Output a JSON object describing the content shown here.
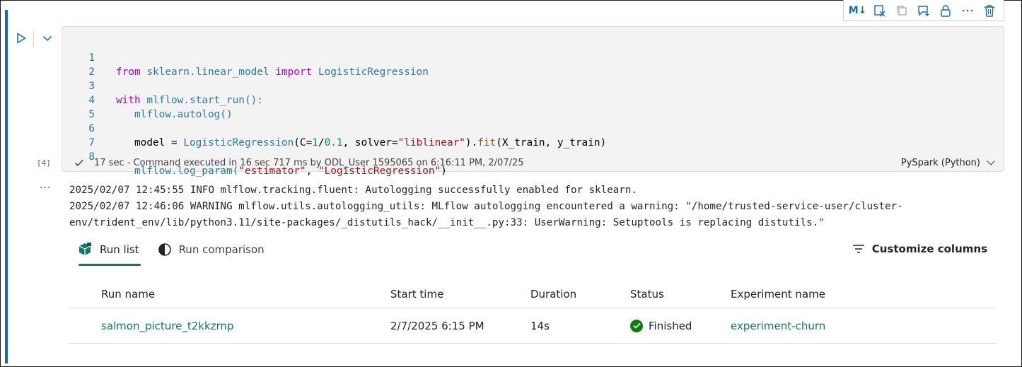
{
  "toolbar": {
    "markdown_label": "M↓",
    "icons": [
      "markdown-toggle-icon",
      "clear-output-icon",
      "copy-icon",
      "add-comment-icon",
      "lock-icon",
      "more-icon",
      "delete-icon"
    ]
  },
  "cell": {
    "exec_count": "[4]",
    "code_lines": [
      {
        "n": "1"
      },
      {
        "n": "2"
      },
      {
        "n": "3"
      },
      {
        "n": "4"
      },
      {
        "n": "5"
      },
      {
        "n": "6"
      },
      {
        "n": "7"
      },
      {
        "n": "8"
      }
    ],
    "code_text": {
      "l1_from": "from",
      "l1_mod": "sklearn.linear_model",
      "l1_import": "import",
      "l1_cls": "LogisticRegression",
      "l3_with": "with",
      "l3_rest": "mlflow.start_run():",
      "l4": "mlflow.autolog()",
      "l6_a": "model = ",
      "l6_cls": "LogisticRegression",
      "l6_b": "(C=",
      "l6_n1": "1",
      "l6_c": "/",
      "l6_n2": "0.1",
      "l6_d": ", solver=",
      "l6_s": "\"liblinear\"",
      "l6_e": ").",
      "l6_fit": "fit",
      "l6_f": "(X_train, y_train)",
      "l8_a": "mlflow.log_param(",
      "l8_s1": "\"estimator\"",
      "l8_b": ", ",
      "l8_s2": "\"LogisticRegression\"",
      "l8_c": ")"
    },
    "status_duration": "17 sec",
    "status_text": " - Command executed in 16 sec 717 ms by ODL_User 1595065 on 6:16:11 PM, 2/07/25",
    "language": "PySpark (Python)"
  },
  "output": {
    "menu": "...",
    "log_lines": [
      "2025/02/07 12:45:55 INFO mlflow.tracking.fluent: Autologging successfully enabled for sklearn.",
      "2025/02/07 12:46:06 WARNING mlflow.utils.autologging_utils: MLflow autologging encountered a warning: \"/home/trusted-service-user/cluster-",
      "env/trident_env/lib/python3.11/site-packages/_distutils_hack/__init__.py:33: UserWarning: Setuptools is replacing distutils.\""
    ]
  },
  "tabs": [
    {
      "label": "Run list",
      "active": true
    },
    {
      "label": "Run comparison",
      "active": false
    }
  ],
  "customize_label": "Customize columns",
  "table": {
    "headers": [
      "Run name",
      "Start time",
      "Duration",
      "Status",
      "Experiment name"
    ],
    "rows": [
      {
        "run_name": "salmon_picture_t2kkzrnp",
        "start_time": "2/7/2025 6:15 PM",
        "duration": "14s",
        "status": "Finished",
        "experiment": "experiment-churn"
      }
    ]
  },
  "colors": {
    "accent": "#0f6cbd",
    "link": "#117865",
    "success": "#107c10"
  }
}
